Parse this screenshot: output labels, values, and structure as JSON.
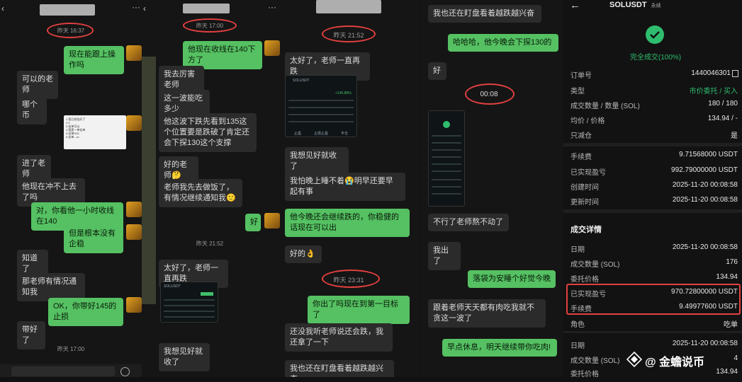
{
  "colors": {
    "accent_green": "#55c162",
    "success_green": "#2ebd6e",
    "highlight_red": "#e34040",
    "bg_dark": "#151515"
  },
  "panel1": {
    "timestamp": "昨天 16:37",
    "messages": [
      {
        "text": "现在能跟上操作吗",
        "side": "right"
      },
      {
        "text": "可以的老师",
        "side": "left"
      },
      {
        "text": "哪个币",
        "side": "left"
      },
      {
        "text": "进了老师",
        "side": "left"
      },
      {
        "text": "他现在冲不上去了吗",
        "side": "left"
      },
      {
        "text": "对，你看他一小时收线在140",
        "side": "right"
      },
      {
        "text": "但是根本没有企稳",
        "side": "right"
      },
      {
        "text": "知道了",
        "side": "left"
      },
      {
        "text": "那老师有情况通知我",
        "side": "left"
      },
      {
        "text": "OK，你带好145的止损",
        "side": "right"
      },
      {
        "text": "带好了",
        "side": "left"
      }
    ],
    "timestamp2": "昨天 17:00",
    "note_lines": [
      "1.我已经挂好了",
      "2.0",
      "3.挂单可以",
      "4.我是一单挂单",
      "5.挂单SOL",
      "6.挂单...xx"
    ]
  },
  "panel2": {
    "timestamp": "昨天 17:00",
    "messages": [
      {
        "text": "他现在收线在140下方了",
        "side": "right"
      },
      {
        "text": "我去厉害老师",
        "side": "left"
      },
      {
        "text": "这一波能吃多少",
        "side": "left"
      },
      {
        "text": "他这波下跌先看到135这个位置要是跌破了肯定还会下探130这个支撑",
        "side": "left"
      },
      {
        "text": "好的老师🤔",
        "side": "left"
      },
      {
        "text": "老师我先去做饭了，有情况继续通知我🙂",
        "side": "left"
      },
      {
        "text": "好",
        "side": "right"
      }
    ],
    "timestamp2": "昨天 21:52",
    "messages2": [
      {
        "text": "太好了，老师一直再跌",
        "side": "left"
      },
      {
        "text": "我想见好就收了",
        "side": "left"
      }
    ]
  },
  "panel3": {
    "timestamp": "昨天 21:52",
    "messages": [
      {
        "text": "太好了，老师一直再跌",
        "side": "left"
      },
      {
        "text": "我想见好就收了",
        "side": "left"
      },
      {
        "text": "我怕晚上睡不着😭明早还要早起有事",
        "side": "left"
      },
      {
        "text": "他今晚还会继续跌的，你稳健的话现在可以出",
        "side": "right"
      },
      {
        "text": "好的👌",
        "side": "left"
      }
    ],
    "timestamp2": "昨天 23:31",
    "messages2": [
      {
        "text": "你出了吗现在到第一目标了",
        "side": "right"
      },
      {
        "text": "还没我听老师说还会跌，我还拿了一下",
        "side": "left"
      },
      {
        "text": "我也还在盯盘看着越跌越兴奋",
        "side": "left"
      }
    ],
    "card": {
      "pair": "SOLUSDT",
      "pnl": "+146.88%",
      "btns": [
        "止盈",
        "止损止盈",
        "平仓"
      ]
    }
  },
  "panel4": {
    "messages": [
      {
        "text": "我也还在盯盘看着越跌越兴奋",
        "side": "left"
      },
      {
        "text": "哈哈哈，他今晚会下探130的",
        "side": "right"
      },
      {
        "text": "好",
        "side": "left"
      }
    ],
    "timestamp": "00:08",
    "messages2": [
      {
        "text": "不行了老师熬不动了",
        "side": "left"
      },
      {
        "text": "我出了",
        "side": "left"
      },
      {
        "text": "落袋为安睡个好觉今晚",
        "side": "right"
      },
      {
        "text": "跟着老师天天都有肉吃我就不贪这一波了",
        "side": "left"
      },
      {
        "text": "早点休息，明天继续带你吃肉!",
        "side": "right"
      }
    ]
  },
  "order": {
    "back_icon": "arrow-left-icon",
    "title": "SOLUSDT",
    "title_suffix": "永续",
    "status": "完全成交(100%)",
    "rows": [
      {
        "k": "订单号",
        "v": "1440046301"
      },
      {
        "k": "类型",
        "v": "市价委托 / 买入"
      },
      {
        "k": "成交数量 / 数量 (SOL)",
        "v": "180 / 180"
      },
      {
        "k": "均价 / 价格",
        "v": "134.94 / -"
      },
      {
        "k": "只减仓",
        "v": "是"
      },
      {
        "k": "手续费",
        "v": "9.71568000 USDT"
      },
      {
        "k": "已实现盈亏",
        "v": "992.79000000 USDT"
      },
      {
        "k": "创建时间",
        "v": "2025-11-20 00:08:58"
      },
      {
        "k": "更新时间",
        "v": "2025-11-20 00:08:58"
      }
    ],
    "detail_title": "成交详情",
    "detail_rows": [
      {
        "k": "日期",
        "v": "2025-11-20 00:08:58"
      },
      {
        "k": "成交数量 (SOL)",
        "v": "176"
      },
      {
        "k": "委托价格",
        "v": "134.94"
      },
      {
        "k": "已实现盈亏",
        "v": "970.72800000 USDT"
      },
      {
        "k": "手续费",
        "v": "9.49977600 USDT"
      },
      {
        "k": "角色",
        "v": "吃单"
      },
      {
        "k": "日期",
        "v": "2025-11-20 00:08:58"
      },
      {
        "k": "成交数量 (SOL)",
        "v": "4"
      },
      {
        "k": "委托价格",
        "v": "134.94"
      }
    ],
    "watermark": "@ 金蟾说币"
  }
}
